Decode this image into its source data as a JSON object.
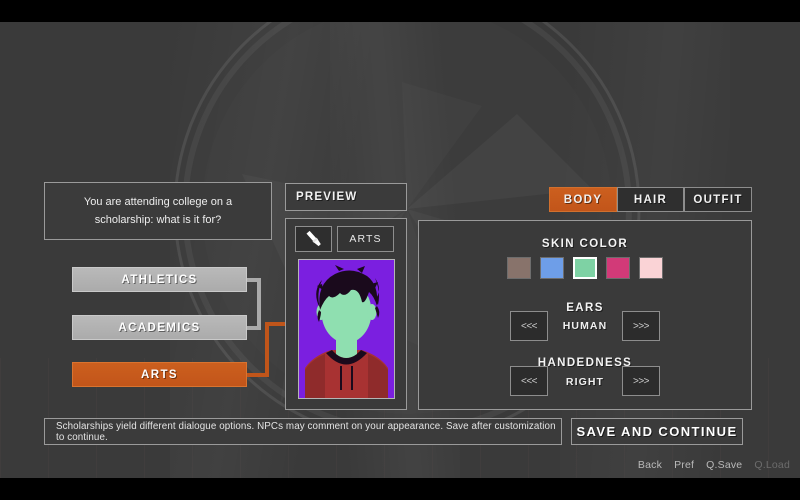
{
  "question": {
    "text": "You are attending college on a scholarship: what is it for?"
  },
  "choices": [
    {
      "label": "ATHLETICS",
      "state": "idle"
    },
    {
      "label": "ACADEMICS",
      "state": "idle"
    },
    {
      "label": "ARTS",
      "state": "selected"
    }
  ],
  "preview": {
    "header_label": "PREVIEW",
    "brush_icon": "paintbrush-icon",
    "tag_label": "ARTS",
    "portrait": {
      "background_color": "#7b1fe0",
      "skin_color": "#8fdfb0",
      "hair_color": "#1a0a1c",
      "shirt_color": "#a83232",
      "collar_color": "#1a0a1c"
    }
  },
  "tabs": [
    {
      "label": "BODY",
      "active": true
    },
    {
      "label": "HAIR",
      "active": false
    },
    {
      "label": "OUTFIT",
      "active": false
    }
  ],
  "body_options": {
    "skin_color": {
      "label": "SKIN COLOR",
      "swatches": [
        {
          "color": "#88736b",
          "selected": false
        },
        {
          "color": "#6e9ee8",
          "selected": false
        },
        {
          "color": "#7ed2a4",
          "selected": true
        },
        {
          "color": "#d23a78",
          "selected": false
        },
        {
          "color": "#fad3d6",
          "selected": false
        }
      ]
    },
    "ears": {
      "label": "EARS",
      "value": "HUMAN",
      "prev_label": "<<<",
      "next_label": ">>>"
    },
    "handedness": {
      "label": "HANDEDNESS",
      "value": "RIGHT",
      "prev_label": "<<<",
      "next_label": ">>>"
    }
  },
  "info_bar": {
    "text": "Scholarships yield different dialogue options. NPCs may comment on your appearance. Save after customization to continue."
  },
  "save_button": {
    "label": "SAVE AND CONTINUE"
  },
  "quick_menu": [
    {
      "label": "Back",
      "enabled": true
    },
    {
      "label": "Pref",
      "enabled": true
    },
    {
      "label": "Q.Save",
      "enabled": true
    },
    {
      "label": "Q.Load",
      "enabled": false
    }
  ],
  "theme": {
    "accent": "#c2551a",
    "panel_bg": "#3a3a3a",
    "stage_bg": "#3a3a3a",
    "border": "#9a9a9a"
  }
}
